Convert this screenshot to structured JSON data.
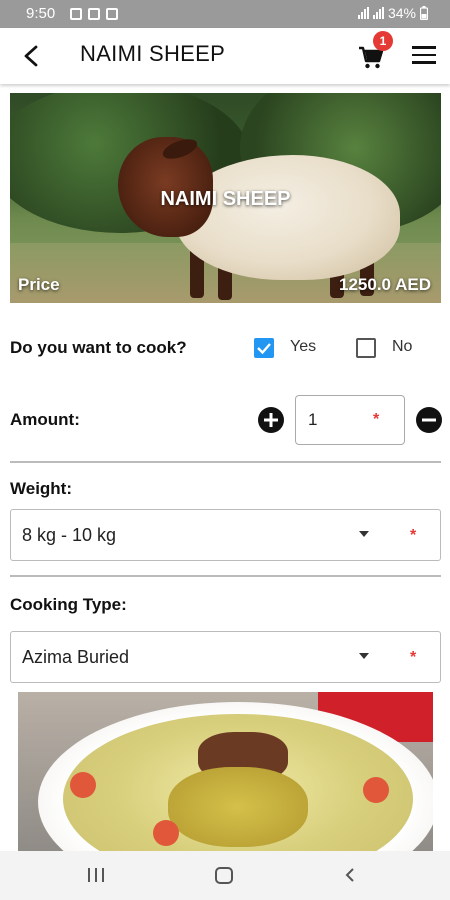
{
  "status_bar": {
    "time": "9:50",
    "battery": "34%"
  },
  "app_bar": {
    "title": "NAIMI SHEEP",
    "cart_count": "1"
  },
  "hero": {
    "title": "NAIMI SHEEP",
    "price_label": "Price",
    "price_value": "1250.0 AED"
  },
  "form": {
    "cook_question": "Do you want to cook?",
    "yes_label": "Yes",
    "no_label": "No",
    "yes_checked": true,
    "no_checked": false,
    "amount_label": "Amount:",
    "amount_value": "1",
    "required_mark": "*",
    "weight_label": "Weight:",
    "weight_value": "8 kg - 10 kg",
    "cooking_type_label": "Cooking Type:",
    "cooking_type_value": "Azima Buried"
  },
  "colors": {
    "accent_checkbox": "#2196f3",
    "badge": "#e53935",
    "required": "#e53935"
  }
}
